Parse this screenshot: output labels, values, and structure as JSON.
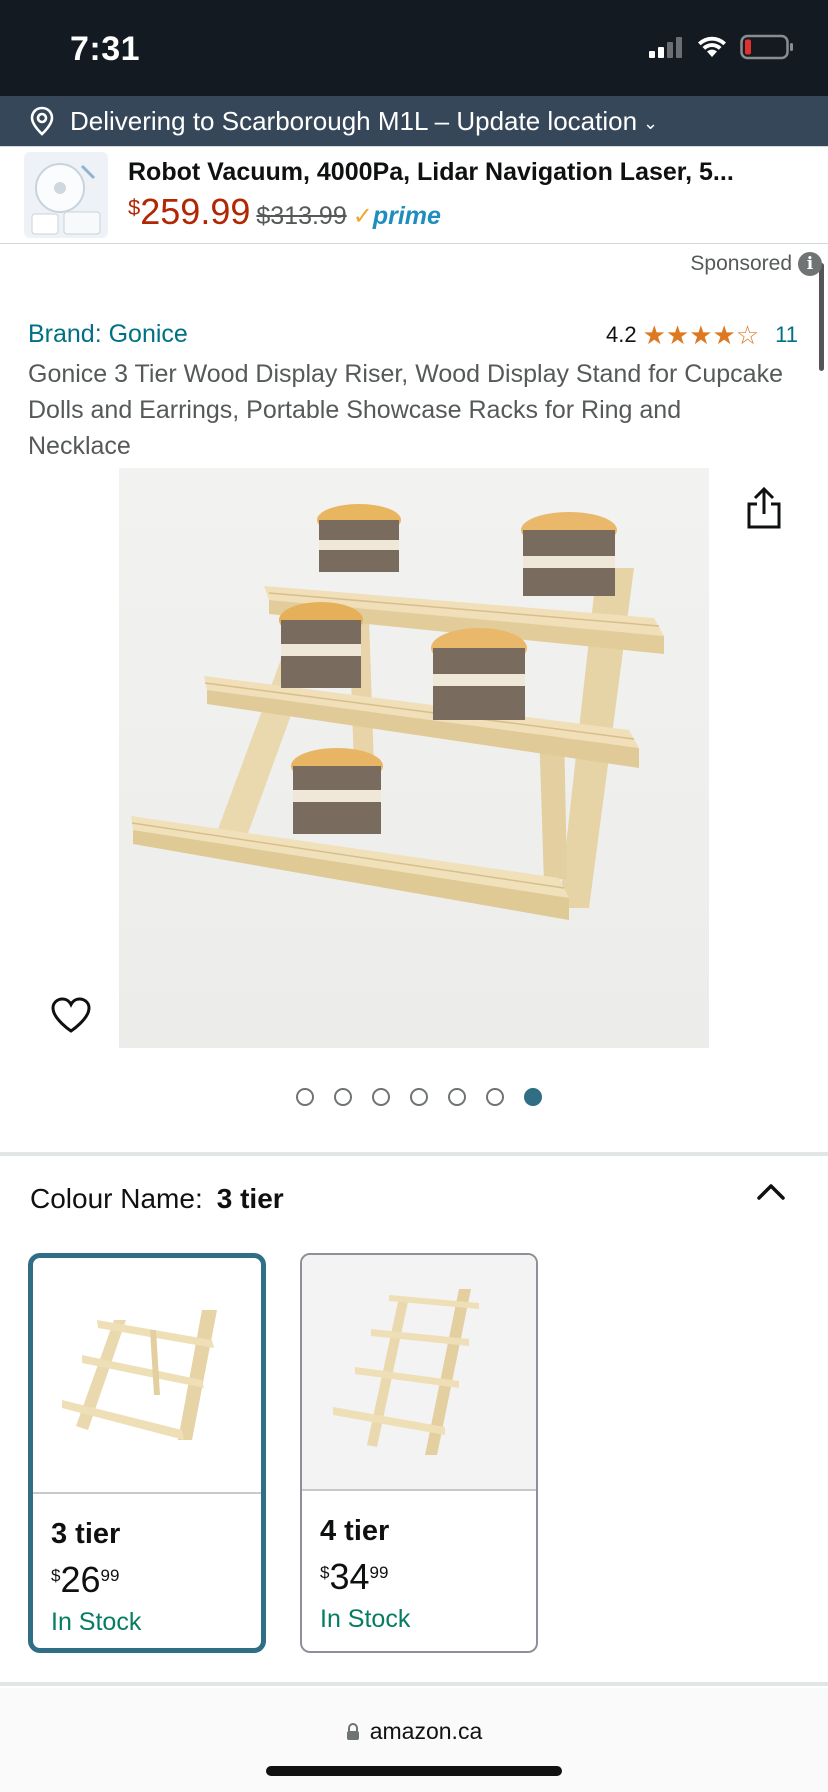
{
  "status_bar": {
    "time": "7:31"
  },
  "delivery": {
    "text": "Delivering to Scarborough M1L – Update location",
    "chevron": "⌄"
  },
  "ad": {
    "title": "Robot Vacuum, 4000Pa, Lidar Navigation Laser, 5...",
    "price_symbol": "$",
    "price": "259.99",
    "old_price": "$313.99",
    "prime_check": "✓",
    "prime_label": "prime",
    "sponsored": "Sponsored",
    "info_glyph": "i"
  },
  "product": {
    "brand": "Brand: Gonice",
    "rating": "4.2",
    "stars_filled": 4,
    "review_count": "11",
    "title": "Gonice 3 Tier Wood Display Riser, Wood Display Stand for Cupcake Dolls and Earrings, Portable Showcase Racks for Ring and Necklace",
    "image_count": 7,
    "active_image": 7
  },
  "variation": {
    "label": "Colour Name:",
    "value": "3 tier",
    "options": [
      {
        "name": "3 tier",
        "currency": "$",
        "whole": "26",
        "fraction": "99",
        "stock": "In Stock",
        "selected": true
      },
      {
        "name": "4 tier",
        "currency": "$",
        "whole": "34",
        "fraction": "99",
        "stock": "In Stock",
        "selected": false
      }
    ]
  },
  "url_bar": {
    "url": "amazon.ca"
  },
  "colors": {
    "link": "#007185",
    "price_red": "#b12704",
    "star": "#de7921",
    "prime_blue": "#1f8ebf",
    "in_stock": "#067d62",
    "selected_border": "#2f6e85",
    "header_dark": "#131a22",
    "delivery_bar": "#37475a",
    "battery_low": "#e0312f"
  },
  "icons": {
    "location": "location-pin-icon",
    "share": "share-icon",
    "wishlist": "heart-icon",
    "collapse": "chevron-up-icon",
    "lock": "lock-icon",
    "info": "info-icon"
  }
}
